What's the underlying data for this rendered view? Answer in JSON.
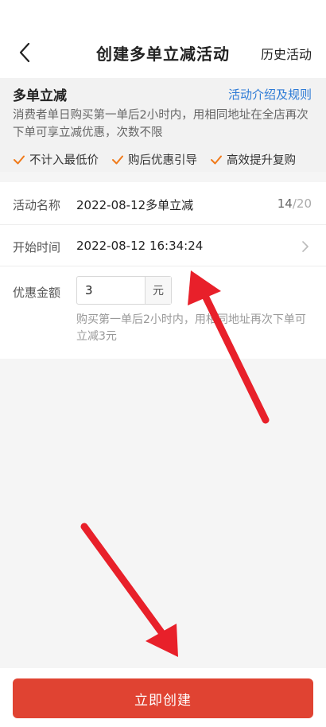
{
  "header": {
    "title": "创建多单立减活动",
    "history_label": "历史活动"
  },
  "info": {
    "title": "多单立减",
    "rules_link": "活动介绍及规则",
    "description": "消费者单日购买第一单后2小时内，用相同地址在全店再次下单可享立减优惠，次数不限",
    "features": [
      "不计入最低价",
      "购后优惠引导",
      "高效提升复购"
    ]
  },
  "form": {
    "name_label": "活动名称",
    "name_value": "2022-08-12多单立减",
    "name_count": "14",
    "name_max": "/20",
    "start_label": "开始时间",
    "start_value": "2022-08-12 16:34:24",
    "amount_label": "优惠金额",
    "amount_value": "3",
    "amount_unit": "元",
    "amount_hint": "购买第一单后2小时内，用相同地址再次下单可立减3元"
  },
  "footer": {
    "create_label": "立即创建"
  },
  "colors": {
    "accent": "#e04332",
    "link": "#2e7bd6",
    "check": "#f07a1a",
    "annotation_arrow": "#e8202a"
  },
  "icons": [
    "back-icon",
    "check-icon",
    "chevron-right-icon"
  ]
}
